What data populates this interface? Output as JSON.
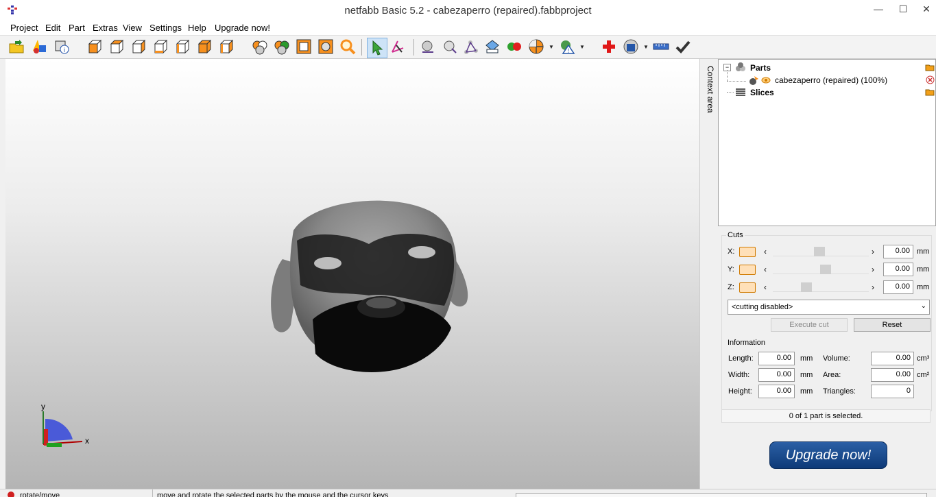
{
  "window": {
    "title": "netfabb Basic 5.2 - cabezaperro (repaired).fabbproject"
  },
  "menu": [
    "Project",
    "Edit",
    "Part",
    "Extras",
    "View",
    "Settings",
    "Help",
    "Upgrade now!"
  ],
  "toolbar": {
    "icons": [
      "open-project-icon",
      "add-part-icon",
      "part-info-icon",
      "view-front-icon",
      "view-back-icon",
      "view-left-icon",
      "view-right-icon",
      "view-top-icon",
      "view-bottom-icon",
      "view-default-icon",
      "zoom-selected-icon",
      "zoom-all-icon",
      "zoom-platform-icon",
      "zoom-parts-icon",
      "zoom-icon",
      "select-tool-icon",
      "move-tool-icon",
      "point-icon",
      "solid-mode-icon",
      "wireframe-icon",
      "measure-icon",
      "color-mode-icon",
      "section-icon",
      "repair-warning-icon",
      "repair-icon",
      "export-icon",
      "ruler-icon",
      "check-icon"
    ]
  },
  "viewport": {
    "axis_y_label": "y",
    "axis_x_label": "x"
  },
  "context": {
    "label": "Context area"
  },
  "tree": {
    "parts_label": "Parts",
    "part_item": "cabezaperro (repaired) (100%)",
    "slices_label": "Slices"
  },
  "cuts": {
    "section_label": "Cuts",
    "x_label": "X:",
    "y_label": "Y:",
    "z_label": "Z:",
    "x_value": "0.00",
    "y_value": "0.00",
    "z_value": "0.00",
    "unit": "mm",
    "dropdown_value": "<cutting disabled>",
    "execute_label": "Execute cut",
    "reset_label": "Reset"
  },
  "information": {
    "section_label": "Information",
    "length_label": "Length:",
    "length_value": "0.00",
    "width_label": "Width:",
    "width_value": "0.00",
    "height_label": "Height:",
    "height_value": "0.00",
    "volume_label": "Volume:",
    "volume_value": "0.00",
    "area_label": "Area:",
    "area_value": "0.00",
    "triangles_label": "Triangles:",
    "triangles_value": "0",
    "unit_mm": "mm",
    "unit_cm3": "cm³",
    "unit_cm2": "cm²"
  },
  "selection": {
    "status": "0 of 1 part is selected."
  },
  "upgrade": {
    "label": "Upgrade now!"
  },
  "statusbar": {
    "mode": "rotate/move",
    "hint": "move and rotate the selected parts by the mouse and the cursor keys"
  }
}
